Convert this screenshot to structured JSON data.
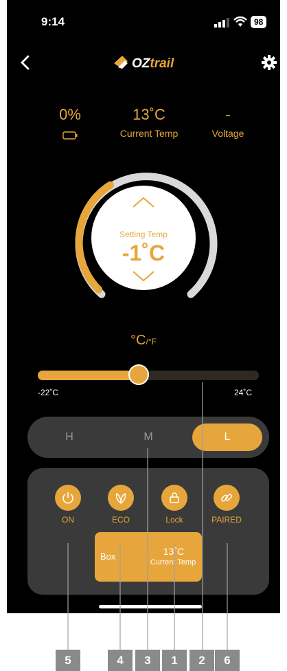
{
  "status_bar": {
    "time": "9:14",
    "battery": "98"
  },
  "header": {
    "brand": "OZtrail"
  },
  "stats": [
    {
      "value": "0%",
      "label_icon": "battery-icon"
    },
    {
      "value": "13˚C",
      "label": "Current Temp"
    },
    {
      "value": "-",
      "label": "Voltage"
    }
  ],
  "dial": {
    "label": "Setting Temp",
    "value": "-1˚C",
    "fill_fraction": 0.38
  },
  "unit_toggle": {
    "primary": "°C",
    "secondary": "/°F"
  },
  "slider": {
    "min_label": "-22˚C",
    "max_label": "24˚C",
    "min": -22,
    "max": 24,
    "value": -1
  },
  "modes": [
    {
      "label": "H",
      "active": false
    },
    {
      "label": "M",
      "active": false
    },
    {
      "label": "L",
      "active": true
    }
  ],
  "controls": [
    {
      "label": "ON",
      "icon": "power-icon"
    },
    {
      "label": "ECO",
      "icon": "leaf-icon"
    },
    {
      "label": "Lock",
      "icon": "lock-icon"
    },
    {
      "label": "PAIRED",
      "icon": "link-icon"
    }
  ],
  "box_card": {
    "name": "Box",
    "temp": "13˚C",
    "temp_label": "Current Temp"
  },
  "callouts": [
    "5",
    "4",
    "3",
    "1",
    "2",
    "6"
  ],
  "colors": {
    "accent": "#e7a63b",
    "background": "#000000",
    "panel": "#3a3a3a",
    "badge": "#8a8a8a"
  }
}
